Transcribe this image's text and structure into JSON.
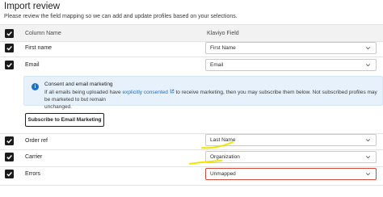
{
  "page": {
    "title": "Import review",
    "subtitle": "Please review the field mapping so we can add and update profiles based on your selections."
  },
  "table": {
    "col_column_name": "Column Name",
    "col_klaviyo_field": "Klaviyo Field",
    "rows": [
      {
        "name": "First name",
        "field": "First Name"
      },
      {
        "name": "Email",
        "field": "Email"
      },
      {
        "name": "Order ref",
        "field": "Last Name"
      },
      {
        "name": "Carrier",
        "field": "Organization"
      },
      {
        "name": "Errors",
        "field": "Unmapped"
      }
    ]
  },
  "consent": {
    "title": "Consent and email marketing",
    "body_prefix": "If all emails being uploaded have",
    "link": "explicitly consented",
    "body_suffix": "to receive marketing, then you may subscribe them below. Not subscribed profiles may be marketed to but remain",
    "body_line2": "unchanged.",
    "button": "Subscribe to Email Marketing"
  },
  "colors": {
    "accent": "#1f6fc4",
    "error": "#d64a3a",
    "highlight": "#f2e600"
  },
  "icons": [
    "check-icon",
    "chevron-down-icon",
    "info-icon",
    "external-link-icon"
  ]
}
